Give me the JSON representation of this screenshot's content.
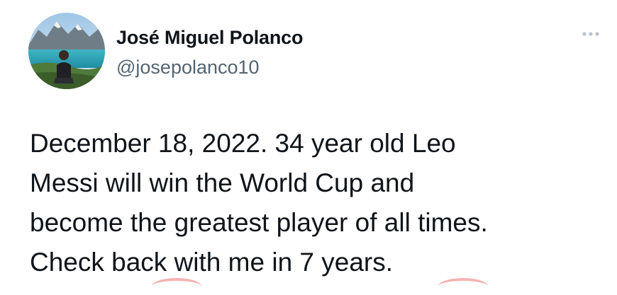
{
  "tweet": {
    "author": {
      "display_name": "José Miguel Polanco",
      "handle": "@josepolanco10",
      "avatar_icon": "profile-photo-lake-mountains"
    },
    "more_icon": "ellipsis-icon",
    "text_lines": [
      "December 18, 2022. 34 year old Leo",
      "Messi will win the World Cup and",
      "become the greatest player of all times.",
      "Check back with me in 7 years."
    ]
  },
  "colors": {
    "text_primary": "#0f1419",
    "text_secondary": "#536471",
    "background": "#ffffff"
  }
}
